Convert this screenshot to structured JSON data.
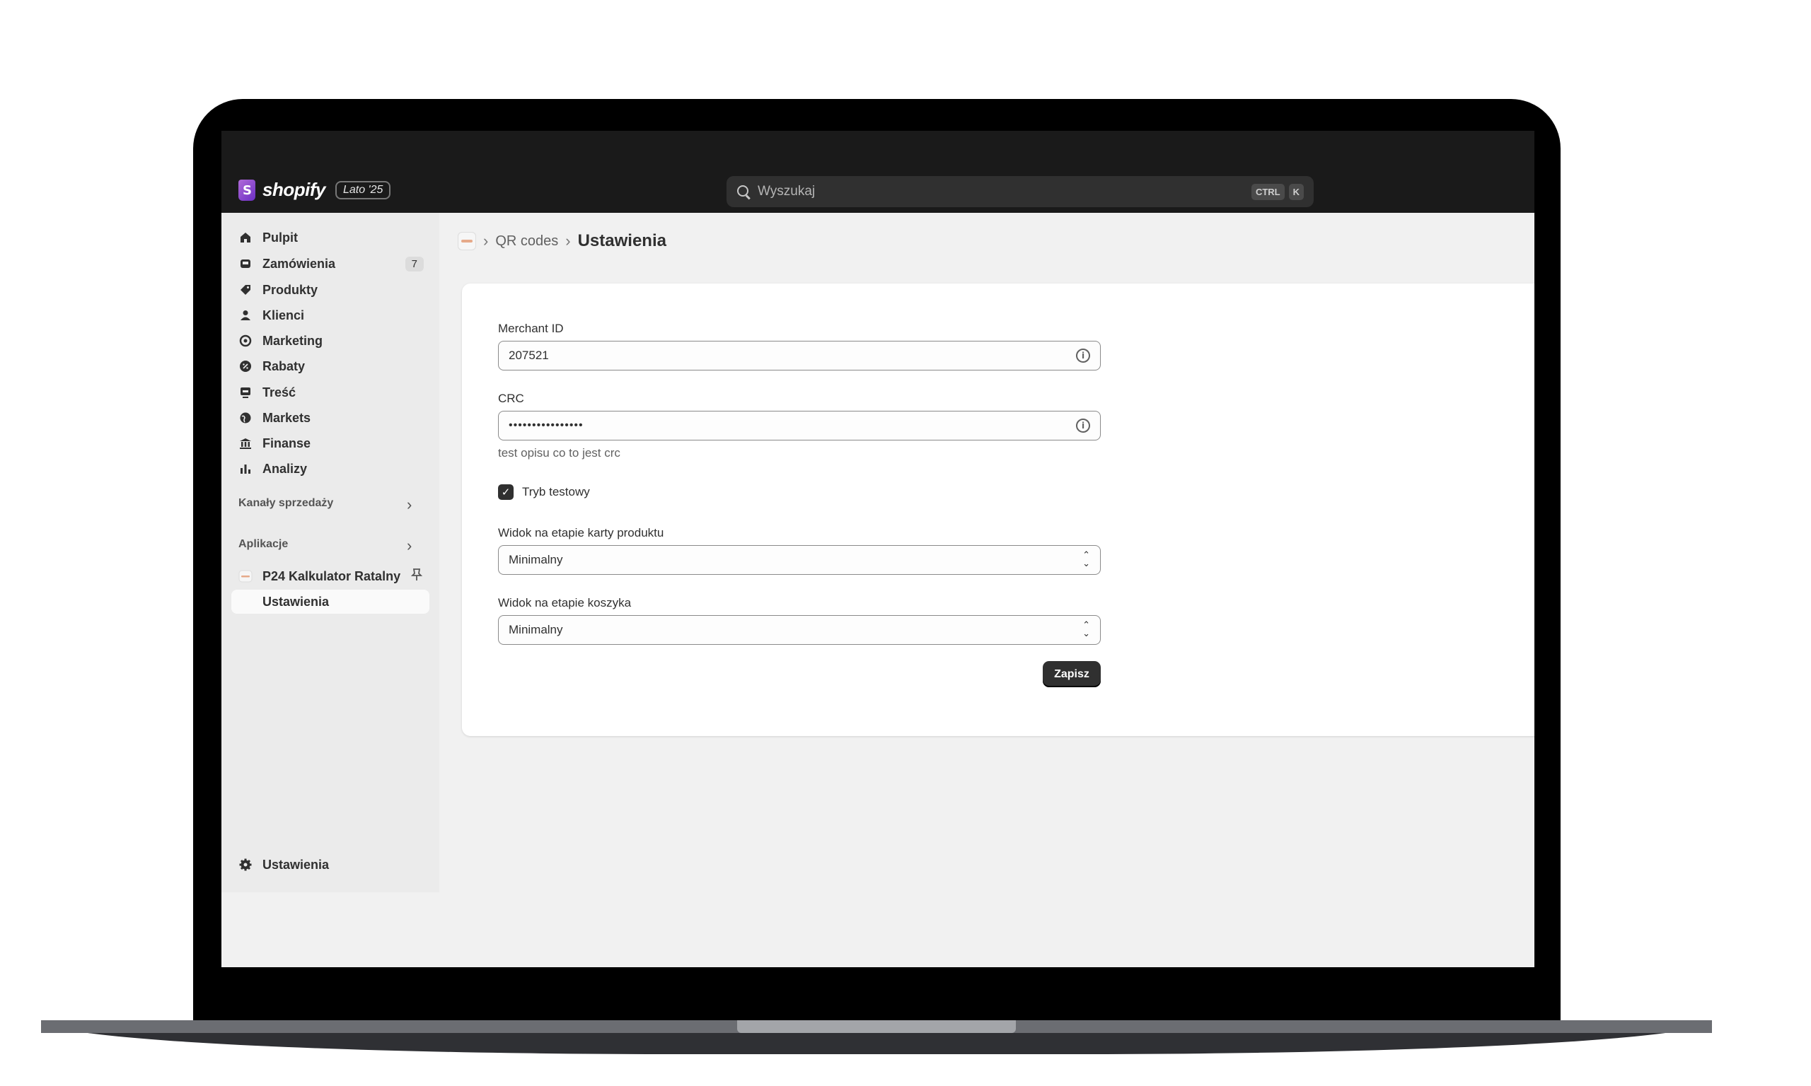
{
  "topbar": {
    "logo_text": "shopify",
    "badge": "Lato '25",
    "search_placeholder": "Wyszukaj",
    "shortcut_ctrl": "CTRL",
    "shortcut_k": "K"
  },
  "sidebar": {
    "items": [
      {
        "label": "Pulpit",
        "icon": "home-icon"
      },
      {
        "label": "Zamówienia",
        "icon": "inbox-icon",
        "badge": "7"
      },
      {
        "label": "Produkty",
        "icon": "tag-icon"
      },
      {
        "label": "Klienci",
        "icon": "person-icon"
      },
      {
        "label": "Marketing",
        "icon": "target-icon"
      },
      {
        "label": "Rabaty",
        "icon": "discount-icon"
      },
      {
        "label": "Treść",
        "icon": "content-icon"
      },
      {
        "label": "Markets",
        "icon": "globe-icon"
      },
      {
        "label": "Finanse",
        "icon": "bank-icon"
      },
      {
        "label": "Analizy",
        "icon": "bar-chart-icon"
      }
    ],
    "sales_channels_label": "Kanały sprzedaży",
    "apps_label": "Aplikacje",
    "app_name": "P24 Kalkulator Ratalny",
    "app_sub_item": "Ustawienia",
    "settings_label": "Ustawienia"
  },
  "breadcrumb": {
    "link": "QR codes",
    "current": "Ustawienia"
  },
  "form": {
    "merchant_id_label": "Merchant ID",
    "merchant_id_value": "207521",
    "crc_label": "CRC",
    "crc_value": "••••••••••••••••",
    "crc_help": "test opisu co to jest crc",
    "test_mode_label": "Tryb testowy",
    "test_mode_checked": true,
    "product_view_label": "Widok na etapie karty produktu",
    "product_view_value": "Minimalny",
    "cart_view_label": "Widok na etapie koszyka",
    "cart_view_value": "Minimalny",
    "save_label": "Zapisz"
  }
}
